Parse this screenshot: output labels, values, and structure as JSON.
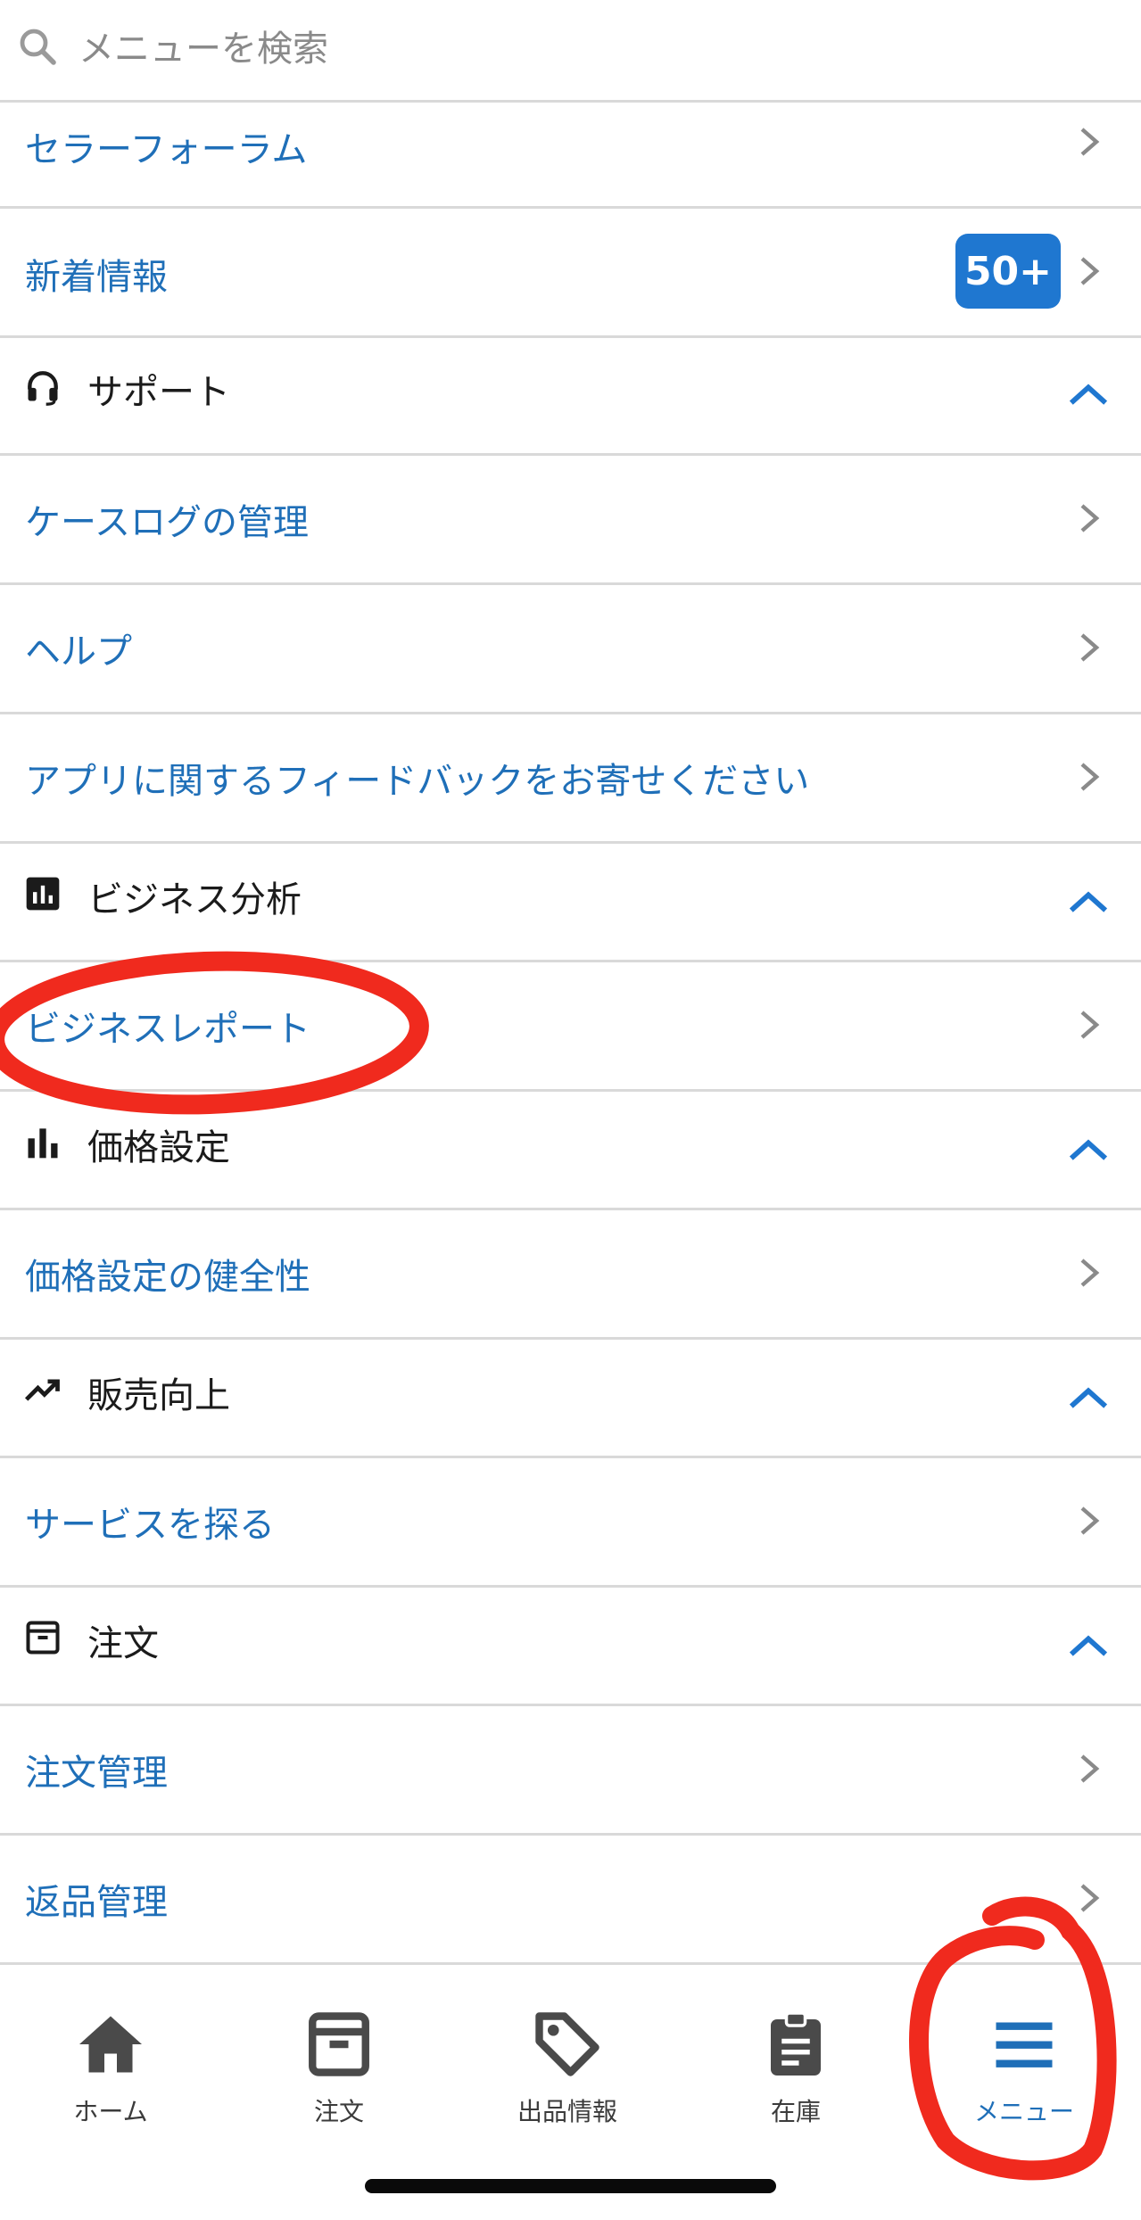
{
  "search": {
    "placeholder": "メニューを検索"
  },
  "menu": {
    "seller_forum": "セラーフォーラム",
    "news": {
      "label": "新着情報",
      "badge": "50+"
    },
    "support": {
      "title": "サポート",
      "items": [
        "ケースログの管理",
        "ヘルプ",
        "アプリに関するフィードバックをお寄せください"
      ]
    },
    "business_analysis": {
      "title": "ビジネス分析",
      "items": [
        "ビジネスレポート"
      ]
    },
    "pricing": {
      "title": "価格設定",
      "items": [
        "価格設定の健全性"
      ]
    },
    "sales_growth": {
      "title": "販売向上",
      "items": [
        "サービスを探る"
      ]
    },
    "orders": {
      "title": "注文",
      "items": [
        "注文管理",
        "返品管理"
      ]
    }
  },
  "tabbar": {
    "tabs": [
      {
        "label": "ホーム",
        "icon": "home-icon"
      },
      {
        "label": "注文",
        "icon": "order-box-icon"
      },
      {
        "label": "出品情報",
        "icon": "tag-icon"
      },
      {
        "label": "在庫",
        "icon": "clipboard-icon"
      },
      {
        "label": "メニュー",
        "icon": "hamburger-icon",
        "active": true
      }
    ]
  },
  "colors": {
    "link": "#1f6fb8",
    "badge": "#1f77d0",
    "annotation": "#f02a1e"
  }
}
